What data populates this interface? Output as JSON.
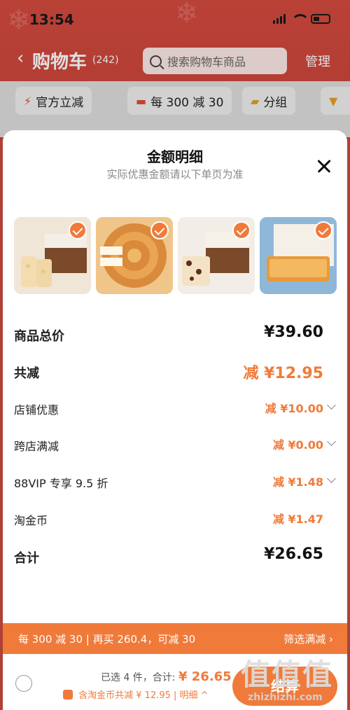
{
  "status": {
    "time": "13:54"
  },
  "nav": {
    "back_icon": "chevron-left-icon",
    "title": "购物车",
    "count": "(242)",
    "search_placeholder": "搜索购物车商品",
    "manage": "管理"
  },
  "filters": [
    {
      "icon": "lightning-icon",
      "label": "官方立减"
    },
    {
      "icon": "coupon-icon",
      "label": "每 300 减 30"
    },
    {
      "icon": "folder-icon",
      "label": "分组"
    }
  ],
  "sheet": {
    "title": "金额明细",
    "subtitle": "实际优惠金额请以下单页为准",
    "products": [
      {
        "name": "sesame-snack-box",
        "selected": true
      },
      {
        "name": "hand-torn-bread",
        "selected": true
      },
      {
        "name": "raisin-snack-box",
        "selected": true
      },
      {
        "name": "toast-box",
        "selected": true
      }
    ],
    "rows": [
      {
        "label": "商品总价",
        "value": "¥39.60",
        "style": "total"
      },
      {
        "label": "共减",
        "value": "减 ¥12.95",
        "style": "discount-total"
      },
      {
        "label": "店铺优惠",
        "value": "减 ¥10.00",
        "style": "item",
        "expandable": true
      },
      {
        "label": "跨店满减",
        "value": "减 ¥0.00",
        "style": "item",
        "expandable": true
      },
      {
        "label": "88VIP 专享 9.5 折",
        "value": "减 ¥1.48",
        "style": "item",
        "expandable": true
      },
      {
        "label": "淘金币",
        "value": "减 ¥1.47",
        "style": "item",
        "expandable": false
      },
      {
        "label": "合计",
        "value": "¥26.65",
        "style": "total"
      }
    ]
  },
  "promo": {
    "text": "每 300 减 30 | 再买 260.4，可减 30",
    "action": "筛选满减 ›"
  },
  "footer": {
    "selected_prefix": "已选 4 件，合计:",
    "total": "¥ 26.65",
    "subsidy": "含淘金币共减 ¥ 12.95 | 明细 ^",
    "pay_button": "结算"
  },
  "watermark": {
    "main": "值值值",
    "url": "zhizhizhi.com"
  },
  "colors": {
    "accent": "#f07a3a",
    "header": "#d44a3e"
  }
}
